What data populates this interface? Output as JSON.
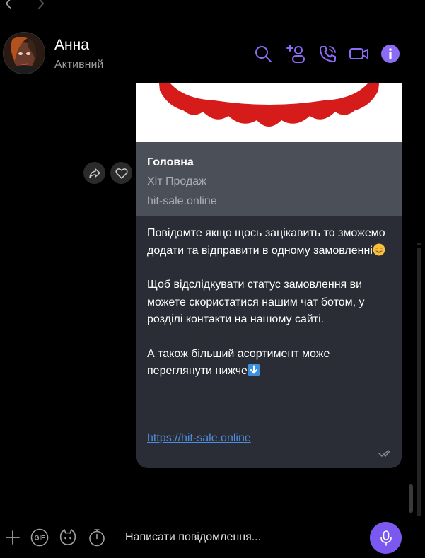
{
  "header": {
    "contact_name": "Анна",
    "contact_status": "Активний"
  },
  "message": {
    "link_preview": {
      "title": "Головна",
      "subtitle": "Хіт Продаж",
      "domain": "hit-sale.online"
    },
    "paragraphs": [
      "Повідомте якщо щось зацікавить то зможемо додати та відправити в одному замовленні",
      "Щоб відслідкувати статус замовлення ви можете скористатися нашим чат ботом, у розділі контакти на нашому сайті.",
      "А також більший асортимент може переглянути  нижче"
    ],
    "link": "https://hit-sale.online"
  },
  "composer": {
    "placeholder": "Написати повідомлення...",
    "gif_label": "GIF"
  },
  "colors": {
    "accent": "#7b59f0",
    "link": "#4c8dde",
    "bubble": "#2a2d35",
    "link_card": "#4b5058"
  },
  "icons": [
    "back-arrow-icon",
    "forward-arrow-icon",
    "search-icon",
    "add-contact-icon",
    "phone-icon",
    "video-call-icon",
    "info-icon",
    "share-icon",
    "heart-icon",
    "delivered-check-icon",
    "plus-icon",
    "gif-icon",
    "sticker-icon",
    "timer-icon",
    "microphone-icon"
  ]
}
